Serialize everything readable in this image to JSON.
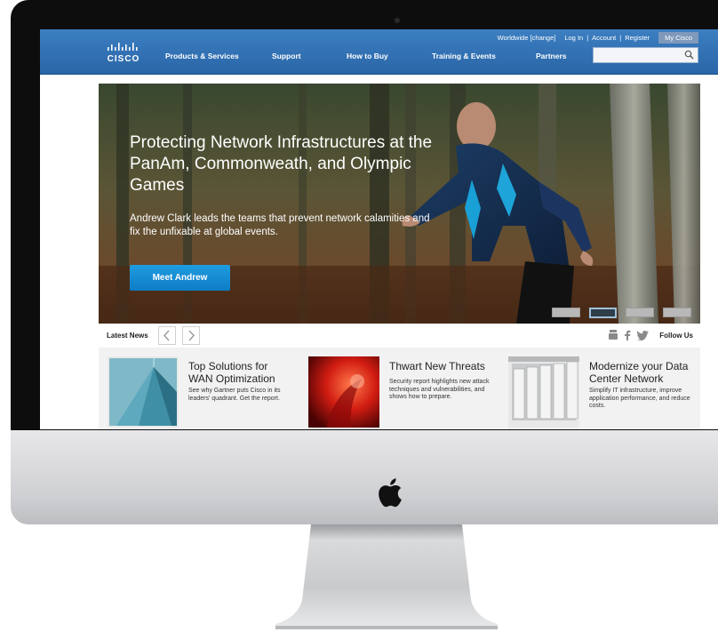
{
  "topbar": {
    "brand": "CISCO",
    "utility": {
      "worldwide": "Worldwide [change]",
      "login": "Log In",
      "account": "Account",
      "register": "Register",
      "mycisco": "My Cisco",
      "separator": "|"
    },
    "nav": [
      "Products & Services",
      "Support",
      "How to Buy",
      "Training & Events",
      "Partners"
    ],
    "search": {
      "placeholder": ""
    }
  },
  "hero": {
    "title": "Protecting Network Infrastructures at the PanAm, Commonweath, and Olympic Games",
    "subtitle": "Andrew Clark leads the teams that prevent network calamities and fix the unfixable at global events.",
    "button": "Meet Andrew",
    "carousel": {
      "slides": 4,
      "active_index": 1
    }
  },
  "news": {
    "label": "Latest News",
    "follow": "Follow Us",
    "social_icons": [
      "youtube-icon",
      "facebook-icon",
      "twitter-icon"
    ],
    "cards": [
      {
        "title": "Top Solutions for WAN Optimization",
        "desc": "See why Gartner puts Cisco in its leaders' quadrant. Get the report.",
        "image": "glass-building"
      },
      {
        "title": "Thwart New Threats",
        "desc": "Security report highlights new attack techniques and vulnerabilities, and shows how to prepare.",
        "image": "red-threat"
      },
      {
        "title": "Modernize your Data Center Network",
        "desc": "Simplify IT infrastructure, improve application performance, and reduce costs.",
        "image": "server-racks"
      }
    ]
  },
  "colors": {
    "nav_blue": "#2a66a8",
    "button_blue": "#0d7cc6",
    "bezel": "#0d0d0d"
  }
}
